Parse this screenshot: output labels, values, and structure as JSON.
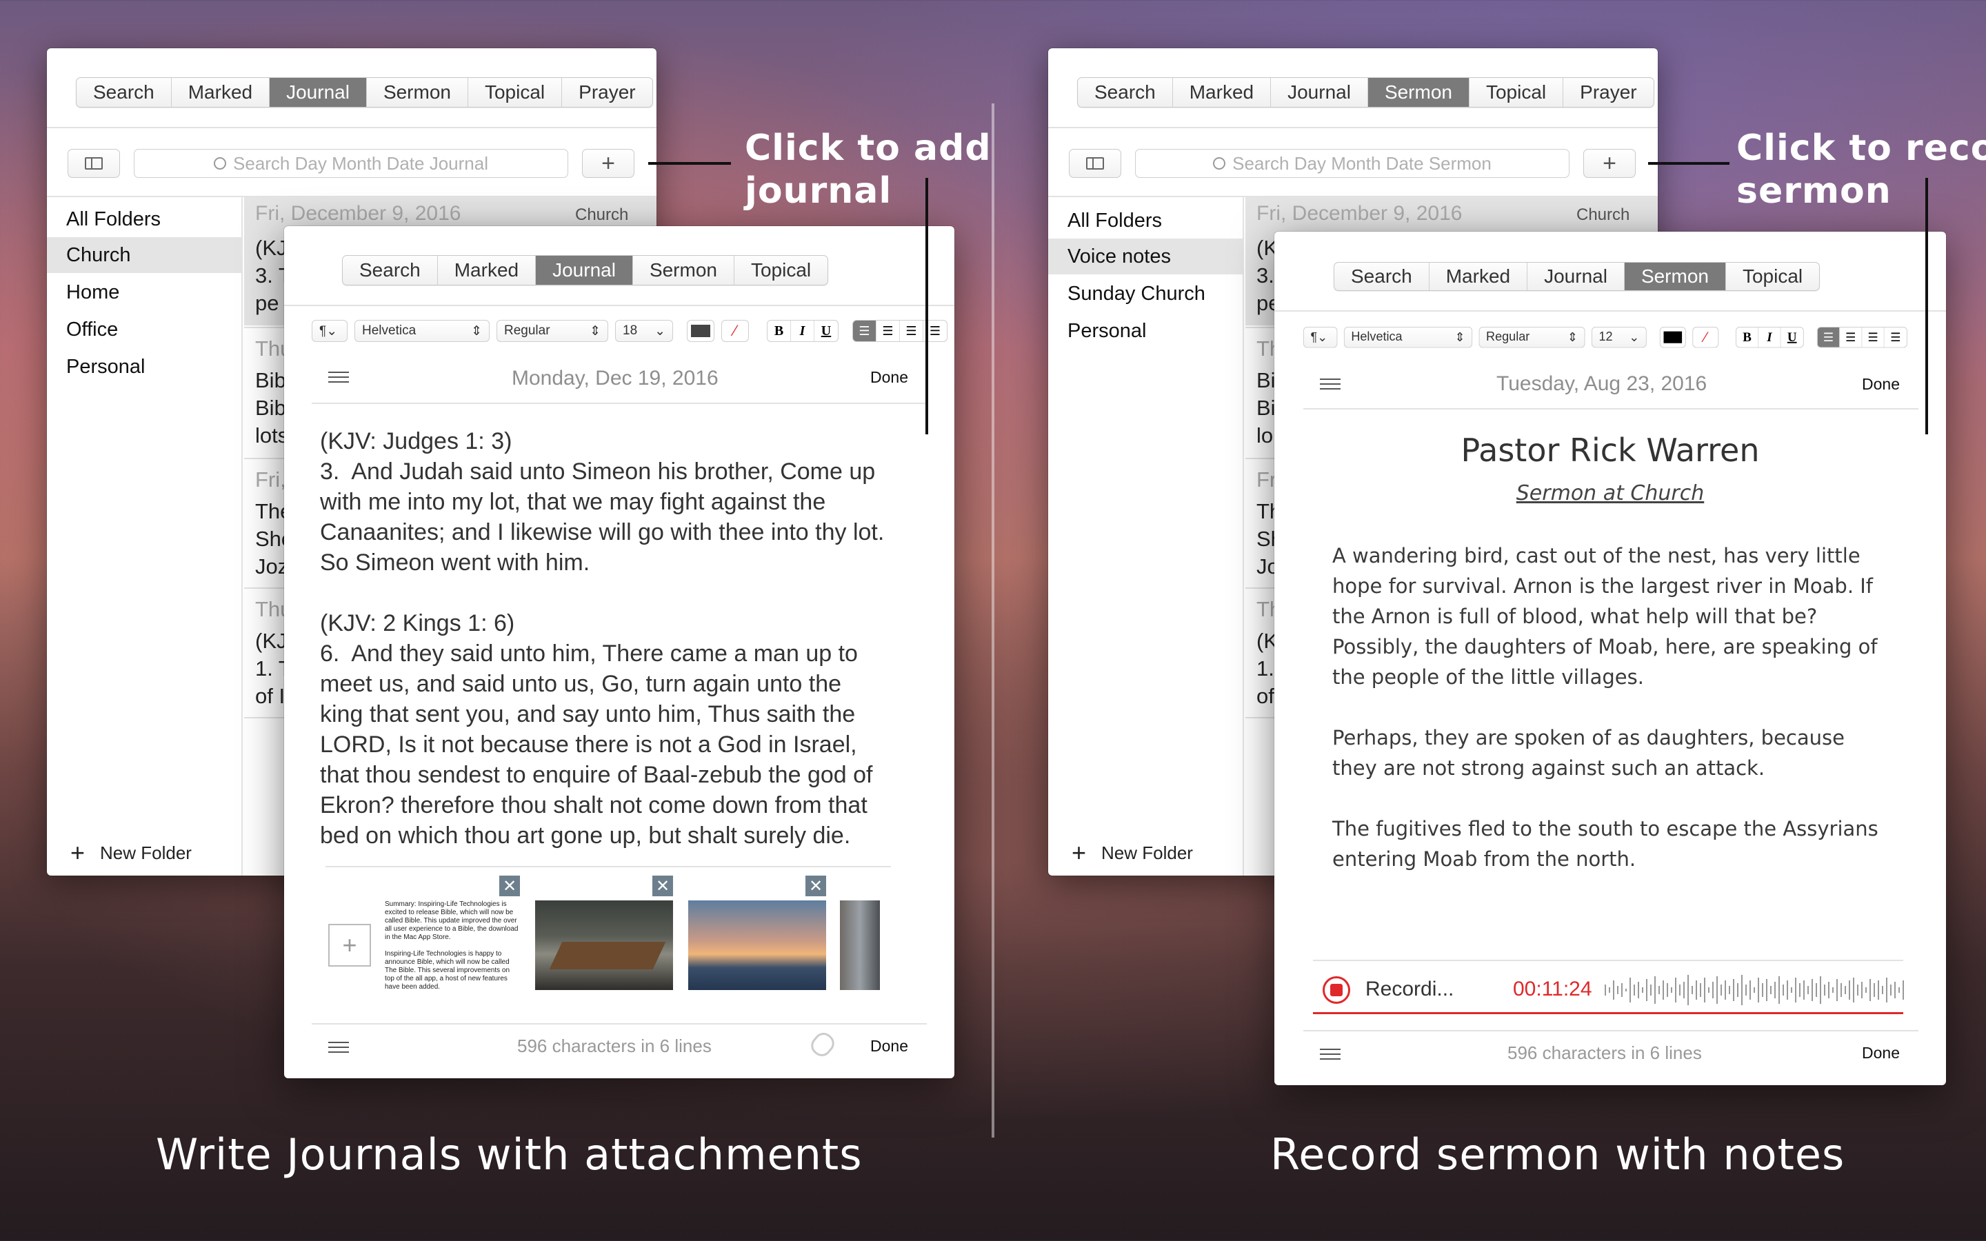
{
  "left": {
    "tabs": [
      "Search",
      "Marked",
      "Journal",
      "Sermon",
      "Topical",
      "Prayer"
    ],
    "search_placeholder": "Search Day Month Date Journal",
    "folders": [
      "All Folders",
      "Church",
      "Home",
      "Office",
      "Personal"
    ],
    "new_folder": "New Folder",
    "list_date": "Fri, December 9, 2016",
    "list_folder": "Church",
    "bg_snips": [
      "(KJ",
      "3. T",
      "pe",
      "Thu",
      "Bib",
      "Bib",
      "lots",
      "Fri,",
      "The",
      "Sho",
      "Joz",
      "Thu",
      "(KJ",
      "1. T",
      "of I"
    ],
    "editor": {
      "tabs": [
        "Search",
        "Marked",
        "Journal",
        "Sermon",
        "Topical"
      ],
      "font": "Helvetica",
      "style": "Regular",
      "size": "18",
      "date": "Monday, Dec 19, 2016",
      "done": "Done",
      "body": "(KJV: Judges 1: 3)\n3.  And Judah said unto Simeon his brother, Come up\nwith me into my lot, that we may fight against the\nCanaanites; and I likewise will go with thee into thy lot.\nSo Simeon went with him.\n\n(KJV: 2 Kings 1: 6)\n6.  And they said unto him, There came a man up to\nmeet us, and said unto us, Go, turn again unto the\nking that sent you, and say unto him, Thus saith the\nLORD, Is it not because there is not a God in Israel,\nthat thou sendest to enquire of Baal-zebub the god of\nEkron? therefore thou shalt not come down from that\nbed on which thou art gone up, but shalt surely die.",
      "doc_thumb_text": "Summary: Inspiring-Life Technologies is excited to release Bible, which will now be called Bible. This update improved the over all user experience to a Bible, the download in the Mac App Store.\n\nInspiring-Life Technologies is happy to announce Bible, which will now be called The Bible. This several improvements on top of the all app, a host of new features have been added.",
      "footer": "596 characters in 6 lines",
      "footer_done": "Done"
    },
    "callout": "Click to add\njournal",
    "caption": "Write Journals with attachments"
  },
  "right": {
    "tabs": [
      "Search",
      "Marked",
      "Journal",
      "Sermon",
      "Topical",
      "Prayer"
    ],
    "search_placeholder": "Search Day Month Date Sermon",
    "folders": [
      "All Folders",
      "Voice notes",
      "Sunday Church",
      "Personal"
    ],
    "new_folder": "New Folder",
    "list_date": "Fri, December 9, 2016",
    "list_folder": "Church",
    "bg_snips": [
      "(K",
      "3.",
      "pe",
      "Th",
      "Bi",
      "Bi",
      "lo",
      "Fr",
      "Th",
      "Sh",
      "Jo",
      "Th",
      "(K",
      "1.",
      "of"
    ],
    "editor": {
      "tabs": [
        "Search",
        "Marked",
        "Journal",
        "Sermon",
        "Topical"
      ],
      "font": "Helvetica",
      "style": "Regular",
      "size": "12",
      "date": "Tuesday, Aug 23, 2016",
      "done": "Done",
      "title": "Pastor Rick Warren",
      "subtitle": "Sermon at Church",
      "body": "A wandering bird, cast out of the nest, has very little\nhope for survival. Arnon is the largest river in Moab. If\nthe Arnon is full of blood, what help will that be?\nPossibly, the daughters of Moab, here, are speaking of\nthe people of the little villages.\n\nPerhaps, they are spoken of as daughters, because\nthey are not strong against such an attack.\n\nThe fugitives fled to the south to escape the Assyrians\nentering Moab from the north.",
      "recording_label": "Recordi...",
      "recording_time": "00:11:24",
      "footer": "596 characters in 6 lines",
      "footer_done": "Done"
    },
    "callout": "Click to record\nsermon",
    "caption": "Record sermon with notes"
  },
  "colors": {
    "selected_tab": "#7a7a7a",
    "recording_red": "#e0282a"
  }
}
